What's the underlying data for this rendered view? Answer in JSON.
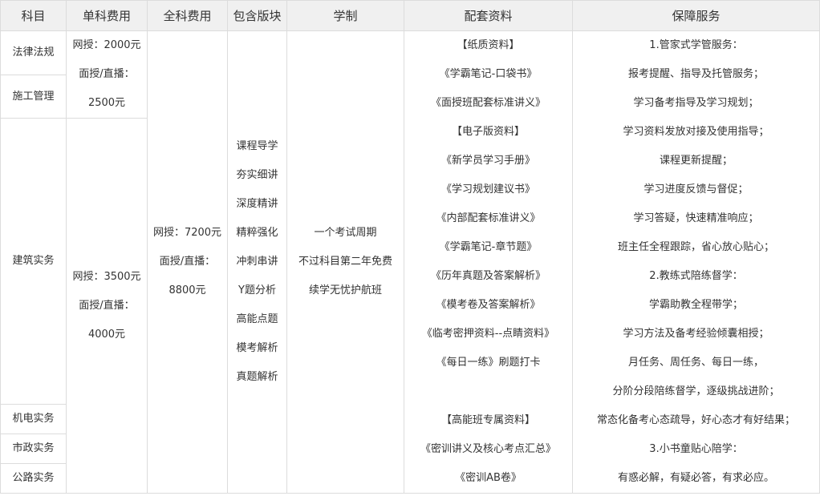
{
  "headers": [
    "科目",
    "单科费用",
    "全科费用",
    "包含版块",
    "学制",
    "配套资料",
    "保障服务"
  ],
  "subjects": [
    "法律法规",
    "施工管理",
    "建筑实务",
    "机电实务",
    "市政实务",
    "公路实务"
  ],
  "single_fee": {
    "group1": [
      "网授：2000元",
      "面授/直播：",
      "2500元"
    ],
    "group2": [
      "网授：3500元",
      "面授/直播：",
      "4000元"
    ]
  },
  "total_fee": [
    "网授：7200元",
    "面授/直播：",
    "8800元"
  ],
  "modules": [
    "课程导学",
    "夯实细讲",
    "深度精讲",
    "精粹强化",
    "冲刺串讲",
    "Y题分析",
    "高能点题",
    "模考解析",
    "真题解析"
  ],
  "schooling": [
    "一个考试周期",
    "不过科目第二年免费",
    "续学无忧护航班"
  ],
  "materials": [
    "【纸质资料】",
    "《学霸笔记-口袋书》",
    "《面授班配套标准讲义》",
    "【电子版资料】",
    "《新学员学习手册》",
    "《学习规划建议书》",
    "《内部配套标准讲义》",
    "《学霸笔记-章节题》",
    "《历年真题及答案解析》",
    "《模考卷及答案解析》",
    "《临考密押资料--点睛资料》",
    "《每日一练》刷题打卡",
    "",
    "【高能班专属资料】",
    "《密训讲义及核心考点汇总》",
    "《密训AB卷》"
  ],
  "services": [
    "1.管家式学管服务：",
    "报考提醒、指导及托管服务；",
    "学习备考指导及学习规划；",
    "学习资料发放对接及使用指导；",
    "课程更新提醒；",
    "学习进度反馈与督促；",
    "学习答疑，快速精准响应；",
    "班主任全程跟踪，省心放心贴心；",
    "2.教练式陪练督学：",
    "学霸助教全程带学；",
    "学习方法及备考经验倾囊相授；",
    "月任务、周任务、每日一练，",
    "分阶分段陪练督学，逐级挑战进阶；",
    "常态化备考心态疏导，好心态才有好结果；",
    "3.小书童贴心陪学：",
    "有惑必解，有疑必答，有求必应。"
  ]
}
